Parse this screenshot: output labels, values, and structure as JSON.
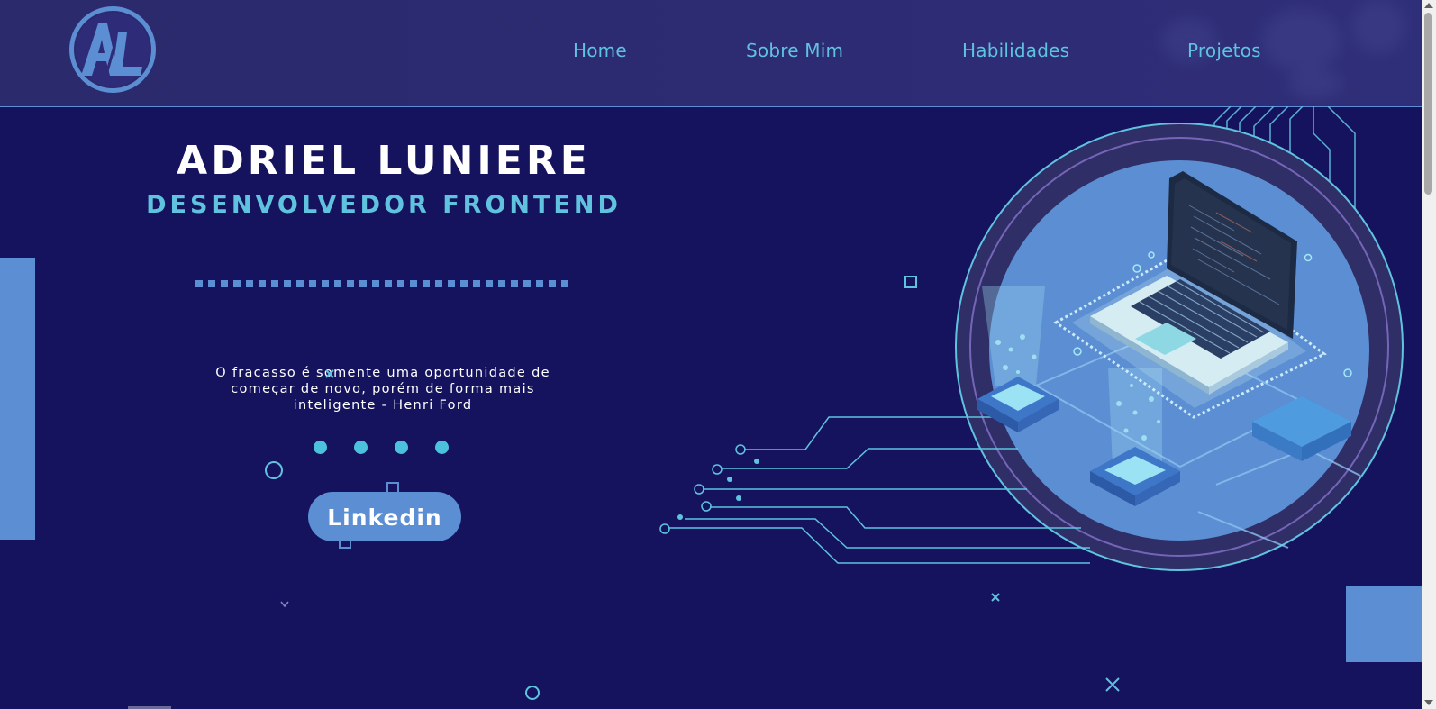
{
  "header": {
    "logo_text": "AL",
    "nav": [
      {
        "label": "Home"
      },
      {
        "label": "Sobre Mim"
      },
      {
        "label": "Habilidades"
      },
      {
        "label": "Projetos"
      }
    ]
  },
  "hero": {
    "name": "ADRIEL LUNIERE",
    "role": "DESENVOLVEDOR FRONTEND",
    "quote": "O fracasso é somente uma oportunidade de começar de novo, porém de forma mais inteligente - Henri Ford",
    "linkedin_label": "Linkedin"
  },
  "colors": {
    "background": "#15135e",
    "header": "#2d2b73",
    "accent_cyan": "#5fc3df",
    "accent_blue": "#5b8ed2"
  }
}
